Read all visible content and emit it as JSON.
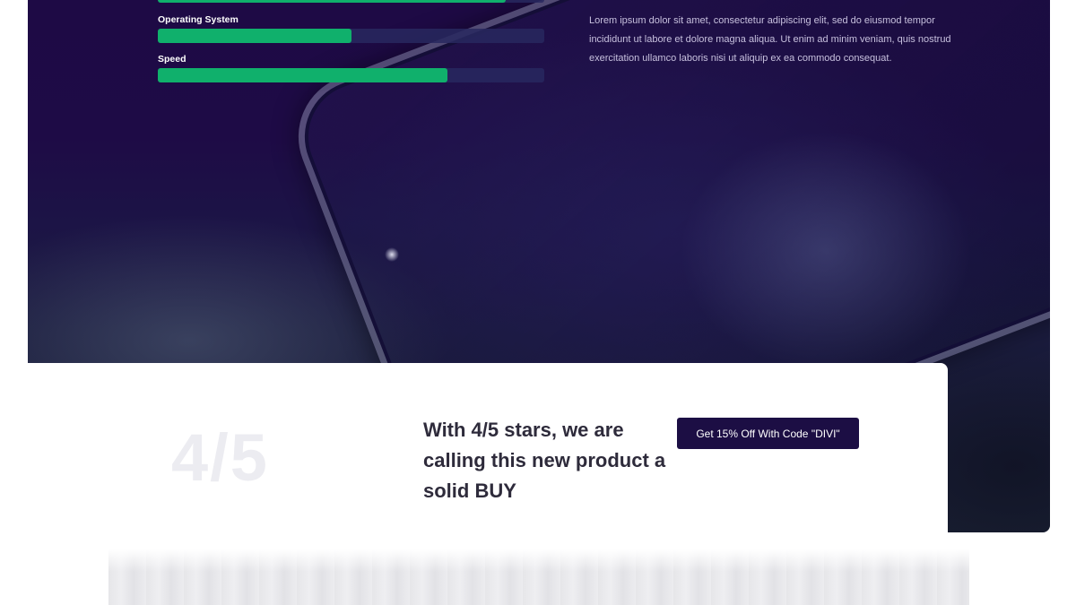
{
  "skills": [
    {
      "label": "",
      "fill_percent": 90
    },
    {
      "label": "Operating System",
      "fill_percent": 50
    },
    {
      "label": "Speed",
      "fill_percent": 75
    }
  ],
  "description": "Lorem ipsum dolor sit amet, consectetur adipiscing elit, sed do eiusmod tempor incididunt ut labore et dolore magna aliqua. Ut enim ad minim veniam, quis nostrud exercitation ullamco laboris nisi ut aliquip ex ea commodo consequat.",
  "rating": {
    "score": "4/5",
    "verdict": "With 4/5 stars, we are calling this new product a solid BUY",
    "cta_label": "Get 15% Off With Code \"DIVI\""
  },
  "colors": {
    "bar_fill": "#10b06c",
    "bar_track": "#28285f",
    "hero_bg": "#1e0a45",
    "cta_bg": "#1c0e44"
  }
}
